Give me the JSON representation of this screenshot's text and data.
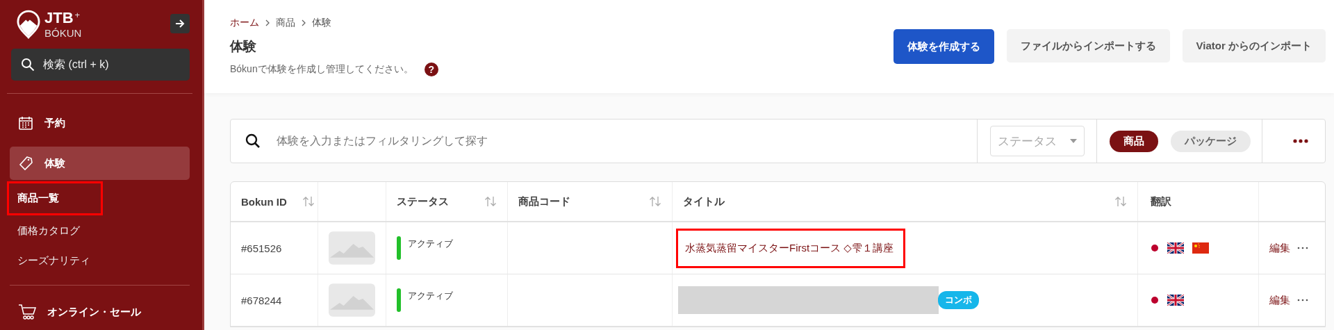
{
  "sidebar": {
    "logo": {
      "name": "JTB",
      "plus": "+",
      "sub": "BÓKUN"
    },
    "search": {
      "placeholder": "検索 (ctrl + k)"
    },
    "items": [
      {
        "kind": "calendar",
        "label": "予約",
        "selected": false
      },
      {
        "kind": "tag",
        "label": "体験",
        "selected": true,
        "children": [
          {
            "label": "商品一覧",
            "selected": true,
            "annotated": true
          },
          {
            "label": "価格カタログ",
            "selected": false,
            "annotated": false
          },
          {
            "label": "シーズナリティ",
            "selected": false,
            "annotated": false
          }
        ]
      },
      {
        "kind": "cart",
        "label": "オンライン・セール",
        "selected": false
      }
    ]
  },
  "breadcrumb": [
    {
      "label": "ホーム",
      "link": true
    },
    {
      "label": "商品",
      "link": false
    },
    {
      "label": "体験",
      "link": false
    }
  ],
  "title": "体験",
  "subtitle": "Bókunで体験を作成し管理してください。",
  "help": "?",
  "actions": [
    {
      "label": "体験を作成する",
      "primary": true
    },
    {
      "label": "ファイルからインポートする",
      "primary": false
    },
    {
      "label": "Viator からのインポート",
      "primary": false
    }
  ],
  "filter": {
    "placeholder": "体験を入力またはフィルタリングして探す",
    "status_placeholder": "ステータス",
    "chips": [
      {
        "label": "商品",
        "selected": true
      },
      {
        "label": "パッケージ",
        "selected": false
      }
    ]
  },
  "table": {
    "columns": [
      {
        "label": "Bokun ID",
        "sortable": true
      },
      {},
      {
        "label": "ステータス",
        "sortable": true
      },
      {
        "label": "商品コード",
        "sortable": true
      },
      {
        "label": "タイトル",
        "sortable": true
      },
      {
        "label": "翻訳",
        "sortable": false
      },
      {}
    ],
    "rows": [
      {
        "id": "#651526",
        "status": {
          "label": "アクティブ",
          "color": "#22c02a"
        },
        "title": {
          "kind": "text",
          "text": "水蒸気蒸留マイスターFirstコース ◇雫１講座",
          "annotated": true
        },
        "translations": [
          {
            "kind": "jp"
          },
          {
            "kind": "uk"
          },
          {
            "kind": "cn"
          }
        ],
        "edit": "編集"
      },
      {
        "id": "#678244",
        "status": {
          "label": "アクティブ",
          "color": "#22c02a"
        },
        "title": {
          "kind": "redacted",
          "annotated": false
        },
        "badge": "コンボ",
        "translations": [
          {
            "kind": "jp"
          },
          {
            "kind": "uk"
          }
        ],
        "edit": "編集"
      }
    ]
  }
}
